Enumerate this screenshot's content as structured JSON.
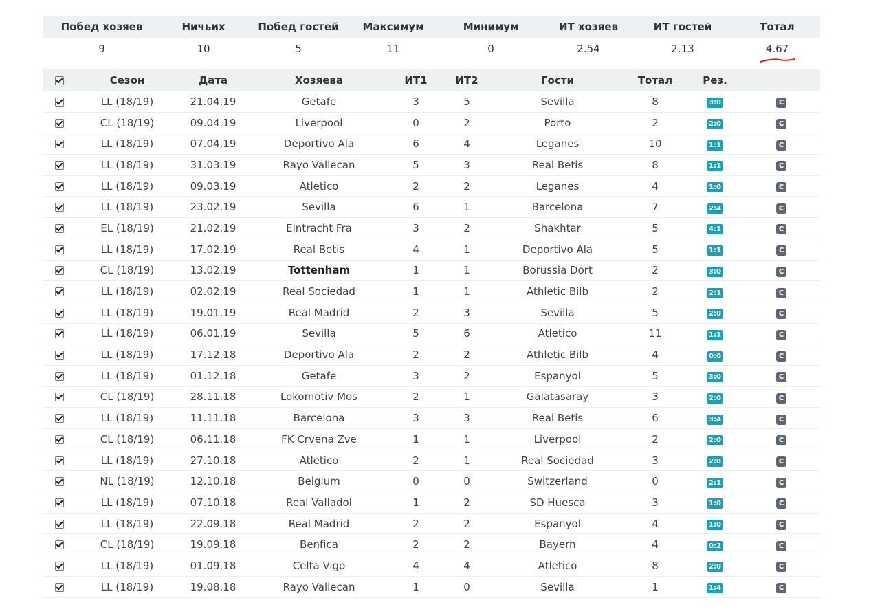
{
  "summary": {
    "headers": [
      "Побед хозяев",
      "Ничьих",
      "Побед гостей",
      "Максимум",
      "Минимум",
      "ИТ хозяев",
      "ИТ гостей",
      "Тотал"
    ],
    "values": [
      "9",
      "10",
      "5",
      "11",
      "0",
      "2.54",
      "2.13",
      "4.67"
    ]
  },
  "matches": {
    "headers": {
      "season": "Сезон",
      "date": "Дата",
      "home": "Хозяева",
      "it1": "ИТ1",
      "it2": "ИТ2",
      "away": "Гости",
      "total": "Тотал",
      "result": "Рез."
    },
    "c_label": "C",
    "rows": [
      {
        "season": "LL (18/19)",
        "date": "21.04.19",
        "home": "Getafe",
        "it1": "3",
        "it2": "5",
        "away": "Sevilla",
        "total": "8",
        "result": "3:0",
        "bold_home": false
      },
      {
        "season": "CL (18/19)",
        "date": "09.04.19",
        "home": "Liverpool",
        "it1": "0",
        "it2": "2",
        "away": "Porto",
        "total": "2",
        "result": "2:0",
        "bold_home": false
      },
      {
        "season": "LL (18/19)",
        "date": "07.04.19",
        "home": "Deportivo Ala",
        "it1": "6",
        "it2": "4",
        "away": "Leganes",
        "total": "10",
        "result": "1:1",
        "bold_home": false
      },
      {
        "season": "LL (18/19)",
        "date": "31.03.19",
        "home": "Rayo Vallecan",
        "it1": "5",
        "it2": "3",
        "away": "Real Betis",
        "total": "8",
        "result": "1:1",
        "bold_home": false
      },
      {
        "season": "LL (18/19)",
        "date": "09.03.19",
        "home": "Atletico",
        "it1": "2",
        "it2": "2",
        "away": "Leganes",
        "total": "4",
        "result": "1:0",
        "bold_home": false
      },
      {
        "season": "LL (18/19)",
        "date": "23.02.19",
        "home": "Sevilla",
        "it1": "6",
        "it2": "1",
        "away": "Barcelona",
        "total": "7",
        "result": "2:4",
        "bold_home": false
      },
      {
        "season": "EL (18/19)",
        "date": "21.02.19",
        "home": "Eintracht Fra",
        "it1": "3",
        "it2": "2",
        "away": "Shakhtar",
        "total": "5",
        "result": "4:1",
        "bold_home": false
      },
      {
        "season": "LL (18/19)",
        "date": "17.02.19",
        "home": "Real Betis",
        "it1": "4",
        "it2": "1",
        "away": "Deportivo Ala",
        "total": "5",
        "result": "1:1",
        "bold_home": false
      },
      {
        "season": "CL (18/19)",
        "date": "13.02.19",
        "home": "Tottenham",
        "it1": "1",
        "it2": "1",
        "away": "Borussia Dort",
        "total": "2",
        "result": "3:0",
        "bold_home": true
      },
      {
        "season": "LL (18/19)",
        "date": "02.02.19",
        "home": "Real Sociedad",
        "it1": "1",
        "it2": "1",
        "away": "Athletic Bilb",
        "total": "2",
        "result": "2:1",
        "bold_home": false
      },
      {
        "season": "LL (18/19)",
        "date": "19.01.19",
        "home": "Real Madrid",
        "it1": "2",
        "it2": "3",
        "away": "Sevilla",
        "total": "5",
        "result": "2:0",
        "bold_home": false
      },
      {
        "season": "LL (18/19)",
        "date": "06.01.19",
        "home": "Sevilla",
        "it1": "5",
        "it2": "6",
        "away": "Atletico",
        "total": "11",
        "result": "1:1",
        "bold_home": false
      },
      {
        "season": "LL (18/19)",
        "date": "17.12.18",
        "home": "Deportivo Ala",
        "it1": "2",
        "it2": "2",
        "away": "Athletic Bilb",
        "total": "4",
        "result": "0:0",
        "bold_home": false
      },
      {
        "season": "LL (18/19)",
        "date": "01.12.18",
        "home": "Getafe",
        "it1": "3",
        "it2": "2",
        "away": "Espanyol",
        "total": "5",
        "result": "3:0",
        "bold_home": false
      },
      {
        "season": "CL (18/19)",
        "date": "28.11.18",
        "home": "Lokomotiv Mos",
        "it1": "2",
        "it2": "1",
        "away": "Galatasaray",
        "total": "3",
        "result": "2:0",
        "bold_home": false
      },
      {
        "season": "LL (18/19)",
        "date": "11.11.18",
        "home": "Barcelona",
        "it1": "3",
        "it2": "3",
        "away": "Real Betis",
        "total": "6",
        "result": "3:4",
        "bold_home": false
      },
      {
        "season": "CL (18/19)",
        "date": "06.11.18",
        "home": "FK Crvena Zve",
        "it1": "1",
        "it2": "1",
        "away": "Liverpool",
        "total": "2",
        "result": "2:0",
        "bold_home": false
      },
      {
        "season": "LL (18/19)",
        "date": "27.10.18",
        "home": "Atletico",
        "it1": "2",
        "it2": "1",
        "away": "Real Sociedad",
        "total": "3",
        "result": "2:0",
        "bold_home": false
      },
      {
        "season": "NL (18/19)",
        "date": "12.10.18",
        "home": "Belgium",
        "it1": "0",
        "it2": "0",
        "away": "Switzerland",
        "total": "0",
        "result": "2:1",
        "bold_home": false
      },
      {
        "season": "LL (18/19)",
        "date": "07.10.18",
        "home": "Real Valladol",
        "it1": "1",
        "it2": "2",
        "away": "SD Huesca",
        "total": "3",
        "result": "1:0",
        "bold_home": false
      },
      {
        "season": "LL (18/19)",
        "date": "22.09.18",
        "home": "Real Madrid",
        "it1": "2",
        "it2": "2",
        "away": "Espanyol",
        "total": "4",
        "result": "1:0",
        "bold_home": false
      },
      {
        "season": "CL (18/19)",
        "date": "19.09.18",
        "home": "Benfica",
        "it1": "2",
        "it2": "2",
        "away": "Bayern",
        "total": "4",
        "result": "0:2",
        "bold_home": false
      },
      {
        "season": "LL (18/19)",
        "date": "01.09.18",
        "home": "Celta Vigo",
        "it1": "4",
        "it2": "4",
        "away": "Atletico",
        "total": "8",
        "result": "2:0",
        "bold_home": false
      },
      {
        "season": "LL (18/19)",
        "date": "19.08.18",
        "home": "Rayo Vallecan",
        "it1": "1",
        "it2": "0",
        "away": "Sevilla",
        "total": "1",
        "result": "1:4",
        "bold_home": false
      }
    ]
  },
  "colors": {
    "badge": "#17a2b8",
    "c_button": "#5f6670",
    "header_bg": "#eef0f2",
    "annotation": "#e02020"
  }
}
